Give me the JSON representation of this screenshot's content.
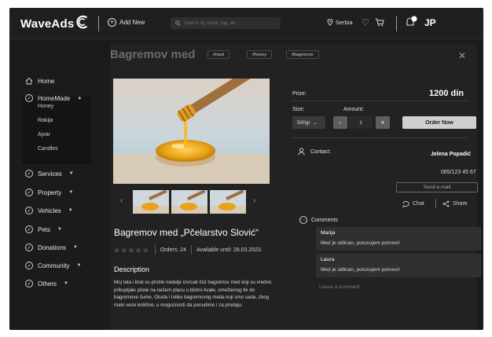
{
  "header": {
    "logo_text": "WaveAds",
    "add_new_label": "Add New",
    "search_placeholder": "Search by name, tag, ad...",
    "region_label": "Serbia",
    "user_initials": "JP"
  },
  "sidebar": {
    "items": [
      {
        "label": "Home",
        "icon": "home-icon"
      },
      {
        "label": "HomeMade",
        "icon": "circle-check-icon",
        "expanded": true
      },
      {
        "label": "Services",
        "icon": "circle-check-icon"
      },
      {
        "label": "Property",
        "icon": "circle-check-icon"
      },
      {
        "label": "Vehicles",
        "icon": "circle-check-icon"
      },
      {
        "label": "Pets",
        "icon": "circle-check-icon"
      },
      {
        "label": "Donations",
        "icon": "circle-check-icon"
      },
      {
        "label": "Community",
        "icon": "circle-check-icon"
      },
      {
        "label": "Others",
        "icon": "circle-check-icon"
      }
    ],
    "subitems": [
      "Honey",
      "Rakija",
      "Ajvar",
      "Candles"
    ]
  },
  "product": {
    "panel_title": "Bagremov med",
    "tags": [
      "#med",
      "#honey",
      "#bagremov"
    ],
    "title": "Bagremov med „Pčelarstvo Slović“",
    "orders": "Orders: 24",
    "available": "Available until: 28.03.2023.",
    "description_heading": "Description",
    "description": "Moj tata i brat su prošle nedelje izvrcali čist bagremov med koji su vredno prikupljale pčele na našem placu u blizini Avale, smeštenog tik do bagremove šume. Otuda i toliko bagremovog meda koji smo sada, zbog malo veće količine, u mogućnosti da ponudimo i za prodaju."
  },
  "purchase": {
    "prize_label": "Prize:",
    "price": "1200 din",
    "size_label": "Size:",
    "amount_label": "Amount:",
    "size_value": "500gr",
    "minus": "-",
    "amount_value": "1",
    "plus": "+",
    "order_label": "Order Now"
  },
  "contact": {
    "label": "Contact:",
    "name": "Jelena Popadić",
    "phone": "065/123 45 67",
    "email_button": "Send e-mail",
    "chat_label": "Chat",
    "share_label": "Share"
  },
  "comments": {
    "heading": "Comments",
    "items": [
      {
        "author": "Marija",
        "text": "Med je odlican, porucujem ponovo!"
      },
      {
        "author": "Laura",
        "text": "Med je odlican, porucujem ponovo!"
      }
    ],
    "leave_placeholder": "Leave a comment"
  },
  "colors": {
    "background": "#1b1b1b",
    "panel": "#222222",
    "honey": "#e8a317",
    "button_light": "#cfcfcf"
  }
}
